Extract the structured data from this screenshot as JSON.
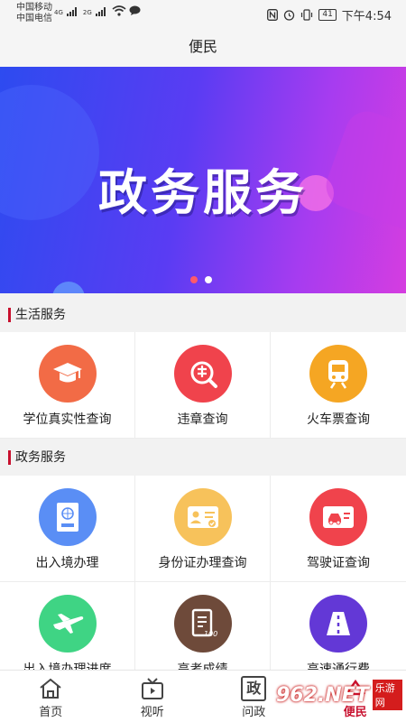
{
  "status": {
    "carrier1": "中国移动",
    "carrier2": "中国电信",
    "net1": "4G",
    "net2": "2G",
    "battery": "41",
    "time": "下午4:54"
  },
  "header": {
    "title": "便民"
  },
  "banner": {
    "title": "政务服务",
    "dot_count": 2,
    "active_index": 0
  },
  "sections": [
    {
      "title": "生活服务",
      "items": [
        {
          "label": "学位真实性查询",
          "icon": "graduation-cap-icon",
          "color": "#f26b46"
        },
        {
          "label": "违章查询",
          "icon": "violation-search-icon",
          "color": "#f0434c"
        },
        {
          "label": "火车票查询",
          "icon": "train-icon",
          "color": "#f5a623"
        }
      ]
    },
    {
      "title": "政务服务",
      "items": [
        {
          "label": "出入境办理",
          "icon": "passport-icon",
          "color": "#5a8ef5"
        },
        {
          "label": "身份证办理查询",
          "icon": "id-card-icon",
          "color": "#f7c25b"
        },
        {
          "label": "驾驶证查询",
          "icon": "driver-license-icon",
          "color": "#f0434c"
        },
        {
          "label": "出入境办理进度",
          "icon": "airplane-icon",
          "color": "#3fd484"
        },
        {
          "label": "高考成绩",
          "icon": "exam-score-icon",
          "color": "#6e4a3a"
        },
        {
          "label": "高速通行费",
          "icon": "highway-icon",
          "color": "#6338d6"
        }
      ]
    }
  ],
  "tabbar": {
    "items": [
      {
        "label": "首页",
        "icon": "home-icon"
      },
      {
        "label": "视听",
        "icon": "tv-icon"
      },
      {
        "label": "问政",
        "icon": "politics-icon",
        "glyph": "政"
      },
      {
        "label": "便民",
        "icon": "service-icon"
      }
    ],
    "active_index": 3
  },
  "watermark": {
    "text": "962.NET",
    "sub": "乐游网"
  }
}
